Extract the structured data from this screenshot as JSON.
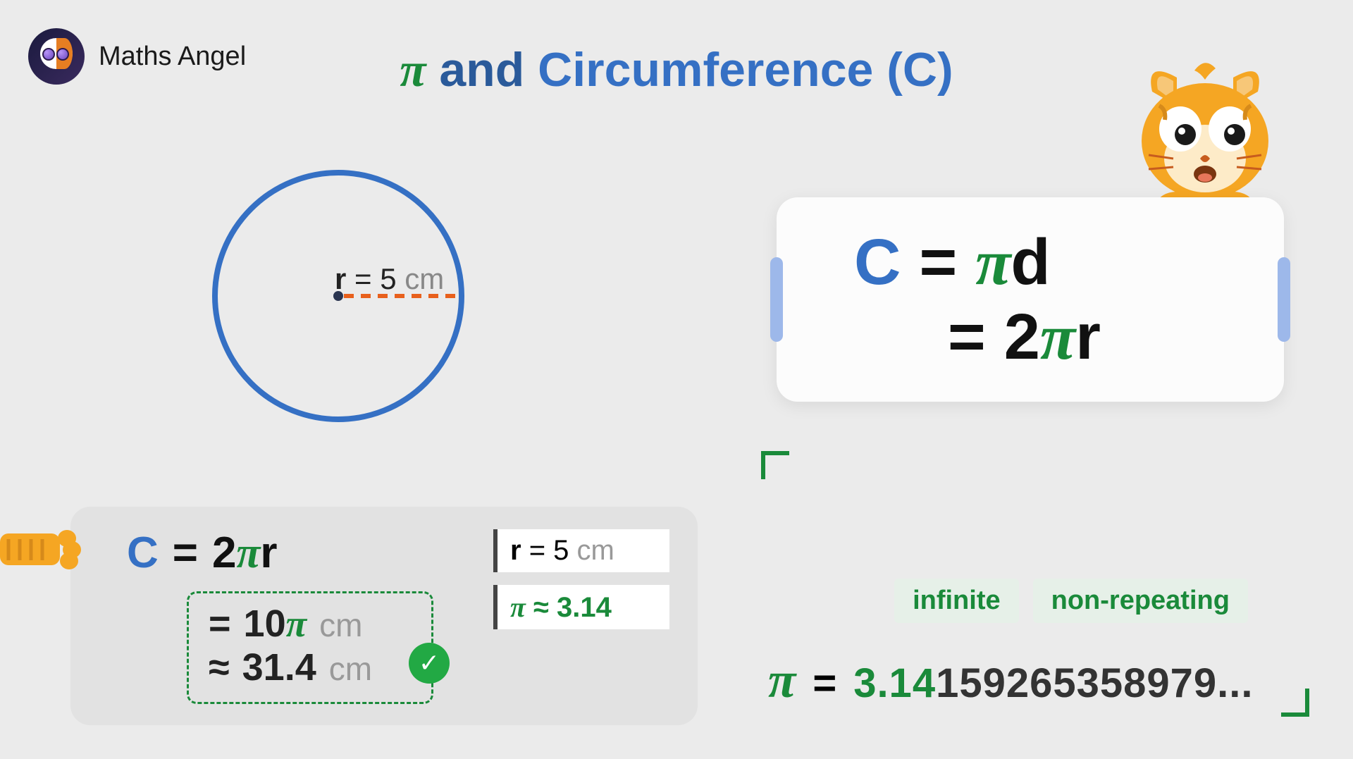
{
  "brand": "Maths Angel",
  "title": {
    "pi": "π",
    "and": " and ",
    "circ": "Circumference (C)"
  },
  "diagram": {
    "radius_var": "r",
    "radius_val": "= 5",
    "radius_unit": " cm"
  },
  "formula_card": {
    "line1": {
      "c": "C",
      "eq": "=",
      "pi": "π",
      "var": "d"
    },
    "line2": {
      "eq": "=",
      "two": "2",
      "pi": "π",
      "var": "r"
    }
  },
  "calc": {
    "main": {
      "c": "C",
      "eq": "=",
      "two": "2",
      "pi": "π",
      "r": "r"
    },
    "result1": {
      "eq": "=",
      "val": "10",
      "pi": "π",
      "unit": "cm"
    },
    "result2": {
      "approx": "≈",
      "val": "31.4",
      "unit": "cm"
    },
    "ref1": {
      "var": "r",
      "val": "= 5",
      "unit": " cm"
    },
    "ref2": {
      "pi": "π",
      "approx": " ≈ ",
      "val": "3.14"
    }
  },
  "pi_section": {
    "tag1": "infinite",
    "tag2": "non-repeating",
    "pi": "π",
    "eq": "=",
    "bold": "3.14",
    "rest": "159265358979..."
  },
  "icons": {
    "check": "✓"
  }
}
